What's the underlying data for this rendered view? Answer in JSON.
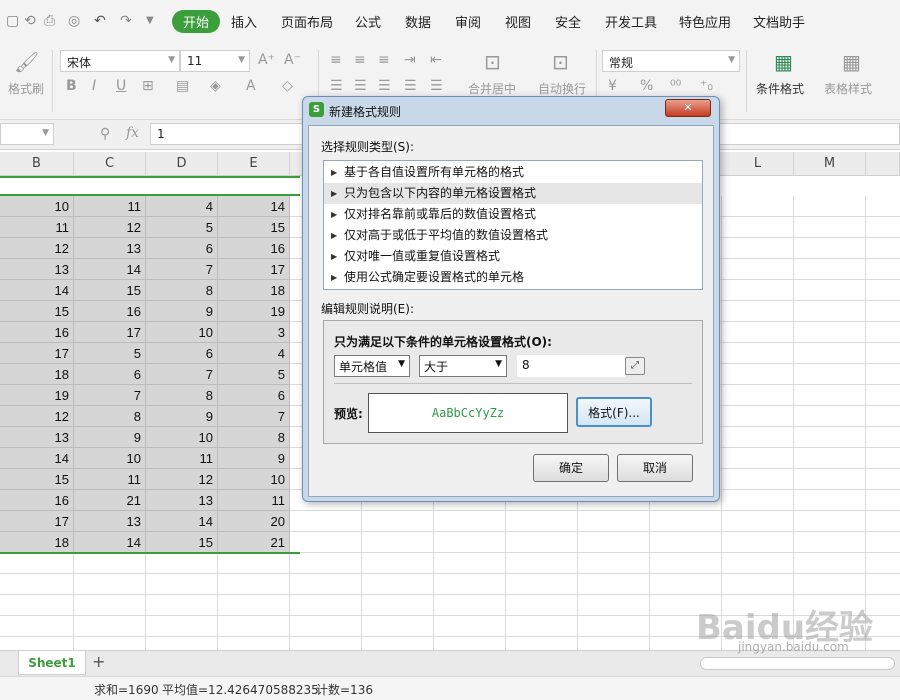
{
  "menu": {
    "tabs": [
      "开始",
      "插入",
      "页面布局",
      "公式",
      "数据",
      "审阅",
      "视图",
      "安全",
      "开发工具",
      "特色应用",
      "文档助手"
    ]
  },
  "ribbon": {
    "format_painter": "格式刷",
    "font_name": "宋体",
    "font_size": "11",
    "merge_center": "合并居中",
    "auto_wrap": "自动换行",
    "number_format": "常规",
    "conditional_format": "条件格式",
    "table_style": "表格样式"
  },
  "formula_bar": {
    "fx": "fx",
    "value": "1"
  },
  "grid": {
    "col_headers": [
      "B",
      "C",
      "D",
      "E",
      "L",
      "M"
    ],
    "rows": [
      [
        "10",
        "11",
        "4",
        "14"
      ],
      [
        "11",
        "12",
        "5",
        "15"
      ],
      [
        "12",
        "13",
        "6",
        "16"
      ],
      [
        "13",
        "14",
        "7",
        "17"
      ],
      [
        "14",
        "15",
        "8",
        "18"
      ],
      [
        "15",
        "16",
        "9",
        "19"
      ],
      [
        "16",
        "17",
        "10",
        "3"
      ],
      [
        "17",
        "5",
        "6",
        "4"
      ],
      [
        "18",
        "6",
        "7",
        "5"
      ],
      [
        "19",
        "7",
        "8",
        "6"
      ],
      [
        "12",
        "8",
        "9",
        "7"
      ],
      [
        "13",
        "9",
        "10",
        "8"
      ],
      [
        "14",
        "10",
        "11",
        "9"
      ],
      [
        "15",
        "11",
        "12",
        "10"
      ],
      [
        "16",
        "21",
        "13",
        "11"
      ],
      [
        "17",
        "13",
        "14",
        "20"
      ],
      [
        "18",
        "14",
        "15",
        "21"
      ]
    ]
  },
  "sheet_tab": "Sheet1",
  "status": {
    "sum": "求和=1690",
    "avg": "平均值=12.426470588235",
    "count": "计数=136"
  },
  "dialog": {
    "title": "新建格式规则",
    "close": "✕",
    "select_type_label": "选择规则类型(S):",
    "rule_types": [
      "基于各自值设置所有单元格的格式",
      "只为包含以下内容的单元格设置格式",
      "仅对排名靠前或靠后的数值设置格式",
      "仅对高于或低于平均值的数值设置格式",
      "仅对唯一值或重复值设置格式",
      "使用公式确定要设置格式的单元格"
    ],
    "edit_desc_label": "编辑规则说明(E):",
    "condition_label": "只为满足以下条件的单元格设置格式(O):",
    "cond_field": "单元格值",
    "cond_op": "大于",
    "cond_value": "8",
    "preview_label": "预览:",
    "preview_text": "AaBbCcYyZz",
    "format_button": "格式(F)...",
    "ok_button": "确定",
    "cancel_button": "取消"
  },
  "watermark": {
    "brand": "Baidu经验",
    "url": "jingyan.baidu.com"
  },
  "colors": {
    "accent_green": "#3a9e3a",
    "selection": "#d6d6d6",
    "preview_green": "#2e9a4a"
  }
}
